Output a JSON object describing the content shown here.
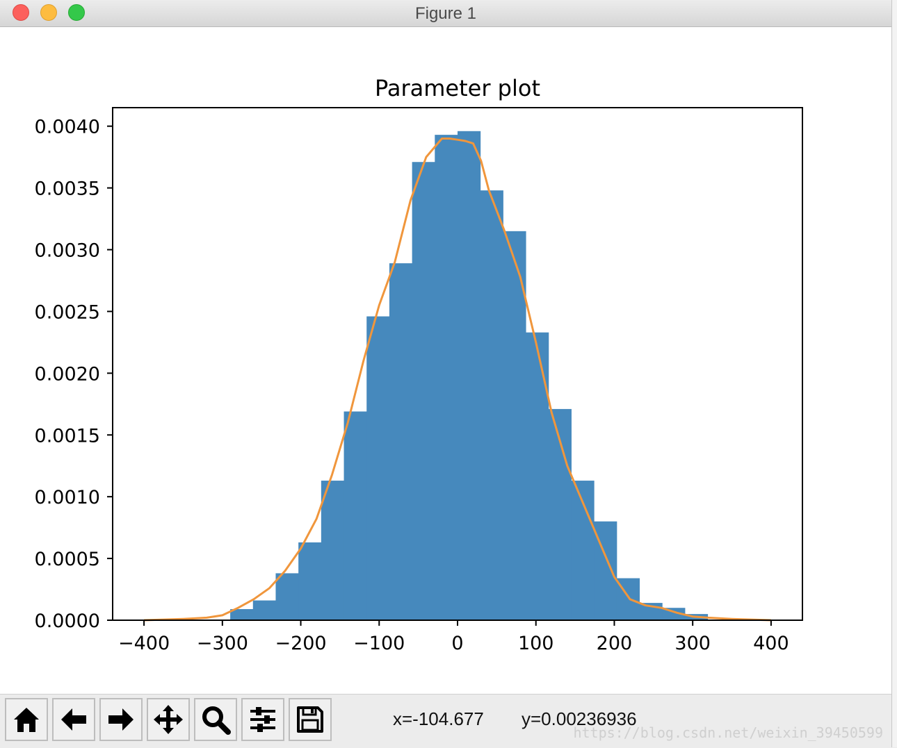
{
  "window": {
    "title": "Figure 1",
    "buttons": [
      "close",
      "minimize",
      "maximize"
    ]
  },
  "toolbar": {
    "tools": [
      {
        "name": "home",
        "icon": "home-icon"
      },
      {
        "name": "back",
        "icon": "back-arrow-icon"
      },
      {
        "name": "forward",
        "icon": "forward-arrow-icon"
      },
      {
        "name": "pan",
        "icon": "pan-icon"
      },
      {
        "name": "zoom",
        "icon": "zoom-icon"
      },
      {
        "name": "configure-subplots",
        "icon": "sliders-icon"
      },
      {
        "name": "save",
        "icon": "save-icon"
      }
    ],
    "x_readout": "x=-104.677",
    "y_readout": "y=0.00236936"
  },
  "watermark": "https://blog.csdn.net/weixin_39450599",
  "colors": {
    "bars": "#4689bd",
    "kde_line": "#f0963c",
    "axes": "#000000"
  },
  "chart_data": {
    "type": "bar",
    "title": "Parameter plot",
    "xlabel": "",
    "ylabel": "",
    "xlim": [
      -440,
      440
    ],
    "ylim": [
      0,
      0.00415
    ],
    "xticks": [
      -400,
      -300,
      -200,
      -100,
      0,
      100,
      200,
      300,
      400
    ],
    "xtick_labels": [
      "−400",
      "−300",
      "−200",
      "−100",
      "0",
      "100",
      "200",
      "300",
      "400"
    ],
    "yticks": [
      0.0,
      0.0005,
      0.001,
      0.0015,
      0.002,
      0.0025,
      0.003,
      0.0035,
      0.004
    ],
    "ytick_labels": [
      "0.0000",
      "0.0005",
      "0.0010",
      "0.0015",
      "0.0020",
      "0.0025",
      "0.0030",
      "0.0035",
      "0.0040"
    ],
    "histogram": {
      "bin_edges": [
        -290,
        -261,
        -232,
        -203,
        -174,
        -145,
        -116,
        -87,
        -58,
        -29,
        0,
        29,
        58,
        87,
        116,
        145,
        174,
        203,
        232,
        261,
        290,
        319
      ],
      "values": [
        9e-05,
        0.00016,
        0.00038,
        0.00063,
        0.00113,
        0.00169,
        0.00246,
        0.00289,
        0.00371,
        0.00393,
        0.00396,
        0.00348,
        0.00315,
        0.00233,
        0.00171,
        0.00113,
        0.0008,
        0.00034,
        0.00014,
        0.0001,
        5e-05
      ]
    },
    "kde": {
      "x": [
        -400,
        -350,
        -320,
        -300,
        -280,
        -260,
        -240,
        -220,
        -200,
        -180,
        -160,
        -140,
        -120,
        -100,
        -80,
        -60,
        -40,
        -20,
        -10,
        0,
        10,
        20,
        30,
        40,
        60,
        80,
        100,
        120,
        140,
        160,
        180,
        200,
        220,
        240,
        260,
        280,
        300,
        320,
        350,
        400
      ],
      "y": [
        0.0,
        1e-05,
        2e-05,
        4e-05,
        0.0001,
        0.00017,
        0.00026,
        0.0004,
        0.00058,
        0.00082,
        0.00118,
        0.0016,
        0.0021,
        0.00255,
        0.0029,
        0.0034,
        0.00375,
        0.0039,
        0.0039,
        0.00389,
        0.00388,
        0.00386,
        0.00372,
        0.00348,
        0.00315,
        0.00278,
        0.00225,
        0.00168,
        0.00125,
        0.00095,
        0.00065,
        0.00035,
        0.00017,
        0.00012,
        0.0001,
        6e-05,
        3e-05,
        2e-05,
        1e-05,
        0.0
      ]
    },
    "grid": false,
    "legend": "none"
  }
}
